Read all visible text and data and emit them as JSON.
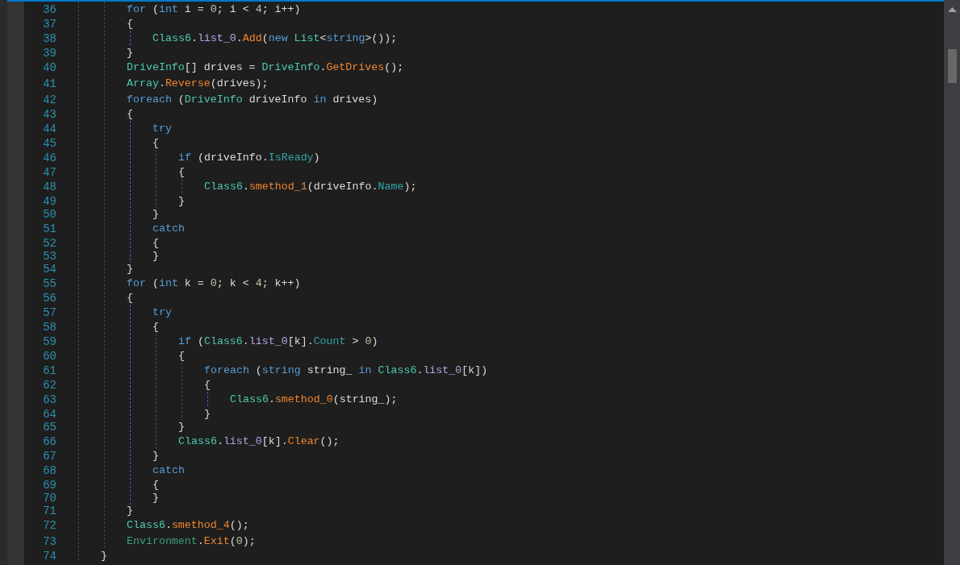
{
  "editor": {
    "lines": [
      {
        "children": [
          {
            "children": [
              {
                "number": "36",
                "kind": "statement",
                "tokens": [
                  {
                    "kind": "keyword",
                    "text": "for"
                  },
                  {
                    "kind": "plain",
                    "text": " ("
                  },
                  {
                    "kind": "keyword",
                    "text": "int"
                  },
                  {
                    "kind": "plain",
                    "text": " i = "
                  },
                  {
                    "kind": "number",
                    "text": "0"
                  },
                  {
                    "kind": "plain",
                    "text": "; i < "
                  },
                  {
                    "kind": "number",
                    "text": "4"
                  },
                  {
                    "kind": "plain",
                    "text": "; i++)"
                  }
                ]
              },
              {
                "number": "37",
                "kind": "brace",
                "tokens": [
                  {
                    "kind": "plain",
                    "text": "{"
                  }
                ],
                "children": [
                  {
                    "number": "38",
                    "kind": "statement",
                    "tokens": [
                      {
                        "kind": "type",
                        "text": "Class6"
                      },
                      {
                        "kind": "plain",
                        "text": "."
                      },
                      {
                        "kind": "field",
                        "text": "list_0"
                      },
                      {
                        "kind": "plain",
                        "text": "."
                      },
                      {
                        "kind": "method",
                        "text": "Add"
                      },
                      {
                        "kind": "plain",
                        "text": "("
                      },
                      {
                        "kind": "keyword",
                        "text": "new "
                      },
                      {
                        "kind": "type",
                        "text": "List"
                      },
                      {
                        "kind": "plain",
                        "text": "<"
                      },
                      {
                        "kind": "keyword",
                        "text": "string"
                      },
                      {
                        "kind": "plain",
                        "text": ">());"
                      }
                    ]
                  }
                ]
              },
              {
                "number": "39",
                "kind": "brace",
                "tokens": [
                  {
                    "kind": "plain",
                    "text": "}"
                  }
                ]
              },
              {
                "number": "40",
                "kind": "statement",
                "tokens": [
                  {
                    "kind": "type",
                    "text": "DriveInfo"
                  },
                  {
                    "kind": "plain",
                    "text": "[] drives = "
                  },
                  {
                    "kind": "type",
                    "text": "DriveInfo"
                  },
                  {
                    "kind": "plain",
                    "text": "."
                  },
                  {
                    "kind": "method",
                    "text": "GetDrives"
                  },
                  {
                    "kind": "plain",
                    "text": "();"
                  }
                ]
              },
              {
                "number": "41",
                "kind": "statement",
                "tokens": [
                  {
                    "kind": "type",
                    "text": "Array"
                  },
                  {
                    "kind": "plain",
                    "text": "."
                  },
                  {
                    "kind": "method",
                    "text": "Reverse"
                  },
                  {
                    "kind": "plain",
                    "text": "(drives);"
                  }
                ]
              },
              {
                "number": "42",
                "kind": "statement",
                "tokens": [
                  {
                    "kind": "keyword",
                    "text": "foreach"
                  },
                  {
                    "kind": "plain",
                    "text": " ("
                  },
                  {
                    "kind": "type",
                    "text": "DriveInfo"
                  },
                  {
                    "kind": "plain",
                    "text": " driveInfo "
                  },
                  {
                    "kind": "keyword",
                    "text": "in"
                  },
                  {
                    "kind": "plain",
                    "text": " drives)"
                  }
                ]
              },
              {
                "number": "43",
                "kind": "brace",
                "tokens": [
                  {
                    "kind": "plain",
                    "text": "{"
                  }
                ],
                "children": [
                  {
                    "number": "44",
                    "kind": "statement",
                    "tokens": [
                      {
                        "kind": "keyword",
                        "text": "try"
                      }
                    ]
                  },
                  {
                    "number": "45",
                    "kind": "brace",
                    "tokens": [
                      {
                        "kind": "plain",
                        "text": "{"
                      }
                    ],
                    "children": [
                      {
                        "number": "46",
                        "kind": "statement",
                        "tokens": [
                          {
                            "kind": "keyword",
                            "text": "if"
                          },
                          {
                            "kind": "plain",
                            "text": " (driveInfo."
                          },
                          {
                            "kind": "property",
                            "text": "IsReady"
                          },
                          {
                            "kind": "plain",
                            "text": ")"
                          }
                        ]
                      },
                      {
                        "number": "47",
                        "kind": "brace",
                        "tokens": [
                          {
                            "kind": "plain",
                            "text": "{"
                          }
                        ],
                        "children": [
                          {
                            "number": "48",
                            "kind": "statement",
                            "tokens": [
                              {
                                "kind": "type",
                                "text": "Class6"
                              },
                              {
                                "kind": "plain",
                                "text": "."
                              },
                              {
                                "kind": "method",
                                "text": "smethod_1"
                              },
                              {
                                "kind": "plain",
                                "text": "(driveInfo."
                              },
                              {
                                "kind": "property",
                                "text": "Name"
                              },
                              {
                                "kind": "plain",
                                "text": ");"
                              }
                            ]
                          }
                        ]
                      },
                      {
                        "number": "49",
                        "kind": "brace",
                        "tokens": [
                          {
                            "kind": "plain",
                            "text": "}"
                          }
                        ]
                      }
                    ]
                  },
                  {
                    "number": "50",
                    "kind": "brace",
                    "tokens": [
                      {
                        "kind": "plain",
                        "text": "}"
                      }
                    ]
                  },
                  {
                    "number": "51",
                    "kind": "statement",
                    "tokens": [
                      {
                        "kind": "keyword",
                        "text": "catch"
                      }
                    ]
                  },
                  {
                    "number": "52",
                    "kind": "brace",
                    "tokens": [
                      {
                        "kind": "plain",
                        "text": "{"
                      }
                    ]
                  },
                  {
                    "number": "53",
                    "kind": "brace",
                    "tokens": [
                      {
                        "kind": "plain",
                        "text": "}"
                      }
                    ]
                  }
                ]
              },
              {
                "number": "54",
                "kind": "brace",
                "tokens": [
                  {
                    "kind": "plain",
                    "text": "}"
                  }
                ]
              },
              {
                "number": "55",
                "kind": "statement",
                "tokens": [
                  {
                    "kind": "keyword",
                    "text": "for"
                  },
                  {
                    "kind": "plain",
                    "text": " ("
                  },
                  {
                    "kind": "keyword",
                    "text": "int"
                  },
                  {
                    "kind": "plain",
                    "text": " k = "
                  },
                  {
                    "kind": "number",
                    "text": "0"
                  },
                  {
                    "kind": "plain",
                    "text": "; k < "
                  },
                  {
                    "kind": "number",
                    "text": "4"
                  },
                  {
                    "kind": "plain",
                    "text": "; k++)"
                  }
                ]
              },
              {
                "number": "56",
                "kind": "brace",
                "tokens": [
                  {
                    "kind": "plain",
                    "text": "{"
                  }
                ],
                "children": [
                  {
                    "number": "57",
                    "kind": "statement",
                    "tokens": [
                      {
                        "kind": "keyword",
                        "text": "try"
                      }
                    ]
                  },
                  {
                    "number": "58",
                    "kind": "brace",
                    "tokens": [
                      {
                        "kind": "plain",
                        "text": "{"
                      }
                    ],
                    "children": [
                      {
                        "number": "59",
                        "kind": "statement",
                        "tokens": [
                          {
                            "kind": "keyword",
                            "text": "if"
                          },
                          {
                            "kind": "plain",
                            "text": " ("
                          },
                          {
                            "kind": "type",
                            "text": "Class6"
                          },
                          {
                            "kind": "plain",
                            "text": "."
                          },
                          {
                            "kind": "field",
                            "text": "list_0"
                          },
                          {
                            "kind": "plain",
                            "text": "[k]."
                          },
                          {
                            "kind": "property",
                            "text": "Count"
                          },
                          {
                            "kind": "plain",
                            "text": " > "
                          },
                          {
                            "kind": "number",
                            "text": "0"
                          },
                          {
                            "kind": "plain",
                            "text": ")"
                          }
                        ]
                      },
                      {
                        "number": "60",
                        "kind": "brace",
                        "tokens": [
                          {
                            "kind": "plain",
                            "text": "{"
                          }
                        ],
                        "children": [
                          {
                            "number": "61",
                            "kind": "statement",
                            "tokens": [
                              {
                                "kind": "keyword",
                                "text": "foreach"
                              },
                              {
                                "kind": "plain",
                                "text": " ("
                              },
                              {
                                "kind": "keyword",
                                "text": "string"
                              },
                              {
                                "kind": "plain",
                                "text": " string_ "
                              },
                              {
                                "kind": "keyword",
                                "text": "in "
                              },
                              {
                                "kind": "type",
                                "text": "Class6"
                              },
                              {
                                "kind": "plain",
                                "text": "."
                              },
                              {
                                "kind": "field",
                                "text": "list_0"
                              },
                              {
                                "kind": "plain",
                                "text": "[k])"
                              }
                            ]
                          },
                          {
                            "number": "62",
                            "kind": "brace",
                            "tokens": [
                              {
                                "kind": "plain",
                                "text": "{"
                              }
                            ],
                            "children": [
                              {
                                "number": "63",
                                "kind": "statement",
                                "tokens": [
                                  {
                                    "kind": "type",
                                    "text": "Class6"
                                  },
                                  {
                                    "kind": "plain",
                                    "text": "."
                                  },
                                  {
                                    "kind": "method",
                                    "text": "smethod_0"
                                  },
                                  {
                                    "kind": "plain",
                                    "text": "(string_);"
                                  }
                                ]
                              }
                            ]
                          },
                          {
                            "number": "64",
                            "kind": "brace",
                            "tokens": [
                              {
                                "kind": "plain",
                                "text": "}"
                              }
                            ]
                          }
                        ]
                      },
                      {
                        "number": "65",
                        "kind": "brace",
                        "tokens": [
                          {
                            "kind": "plain",
                            "text": "}"
                          }
                        ]
                      },
                      {
                        "number": "66",
                        "kind": "statement",
                        "tokens": [
                          {
                            "kind": "type",
                            "text": "Class6"
                          },
                          {
                            "kind": "plain",
                            "text": "."
                          },
                          {
                            "kind": "field",
                            "text": "list_0"
                          },
                          {
                            "kind": "plain",
                            "text": "[k]."
                          },
                          {
                            "kind": "method",
                            "text": "Clear"
                          },
                          {
                            "kind": "plain",
                            "text": "();"
                          }
                        ]
                      }
                    ]
                  },
                  {
                    "number": "67",
                    "kind": "brace",
                    "tokens": [
                      {
                        "kind": "plain",
                        "text": "}"
                      }
                    ]
                  },
                  {
                    "number": "68",
                    "kind": "statement",
                    "tokens": [
                      {
                        "kind": "keyword",
                        "text": "catch"
                      }
                    ]
                  },
                  {
                    "number": "69",
                    "kind": "brace",
                    "tokens": [
                      {
                        "kind": "plain",
                        "text": "{"
                      }
                    ]
                  },
                  {
                    "number": "70",
                    "kind": "brace",
                    "tokens": [
                      {
                        "kind": "plain",
                        "text": "}"
                      }
                    ]
                  }
                ]
              },
              {
                "number": "71",
                "kind": "brace",
                "tokens": [
                  {
                    "kind": "plain",
                    "text": "}"
                  }
                ]
              },
              {
                "number": "72",
                "kind": "statement",
                "tokens": [
                  {
                    "kind": "type",
                    "text": "Class6"
                  },
                  {
                    "kind": "plain",
                    "text": "."
                  },
                  {
                    "kind": "method",
                    "text": "smethod_4"
                  },
                  {
                    "kind": "plain",
                    "text": "();"
                  }
                ]
              },
              {
                "number": "73",
                "kind": "statement",
                "tokens": [
                  {
                    "kind": "static_type",
                    "text": "Environment"
                  },
                  {
                    "kind": "plain",
                    "text": "."
                  },
                  {
                    "kind": "method",
                    "text": "Exit"
                  },
                  {
                    "kind": "plain",
                    "text": "("
                  },
                  {
                    "kind": "number",
                    "text": "0"
                  },
                  {
                    "kind": "plain",
                    "text": ");"
                  }
                ]
              }
            ]
          },
          {
            "number": "74",
            "kind": "brace",
            "tokens": [
              {
                "kind": "plain",
                "text": "}"
              }
            ]
          }
        ]
      }
    ]
  }
}
